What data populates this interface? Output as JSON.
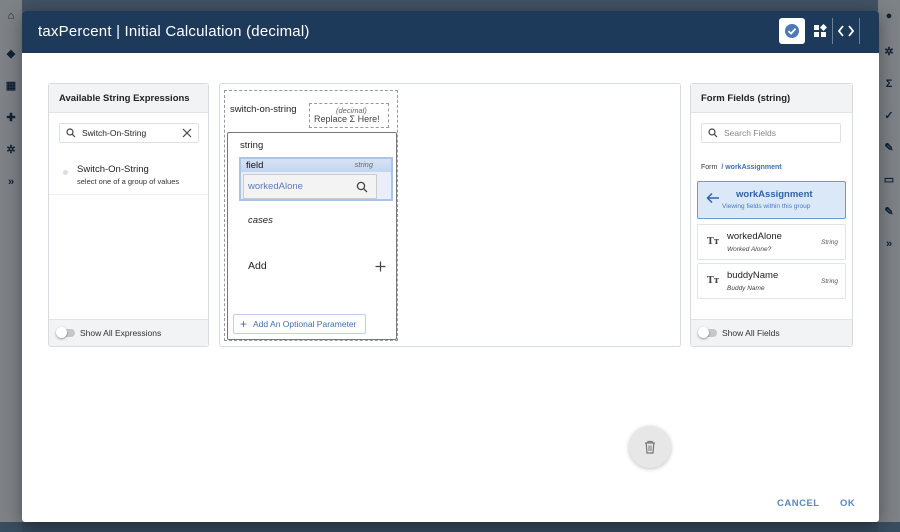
{
  "modal": {
    "title": "taxPercent | Initial Calculation (decimal)"
  },
  "header_actions": {
    "validate_icon": "check-circle-icon",
    "blocks_icon": "widgets-icon",
    "code_icon": "code-icon"
  },
  "expressions_panel": {
    "title": "Available String Expressions",
    "search_value": "Switch-On-String",
    "items": [
      {
        "name": "Switch-On-String",
        "description": "select one of a group of values"
      }
    ],
    "show_all_label": "Show All Expressions"
  },
  "editor": {
    "expression_label": "switch-on-string",
    "result_type": "(decimal)",
    "replace_label": "Replace Σ Here!",
    "block_label": "string",
    "field_label": "field",
    "field_type": "string",
    "field_value": "workedAlone",
    "cases_label": "cases",
    "add_label": "Add",
    "optional_param_label": "Add An Optional Parameter"
  },
  "form_fields_panel": {
    "title": "Form Fields (string)",
    "search_placeholder": "Search Fields",
    "path_root": "Form",
    "path_segment": "/ workAssignment",
    "group": {
      "name": "workAssignment",
      "subtitle": "Viewing fields within this group"
    },
    "fields": [
      {
        "name": "workedAlone",
        "label": "Worked Alone?",
        "type": "String",
        "icon": "text-type-icon"
      },
      {
        "name": "buddyName",
        "label": "Buddy Name",
        "type": "String",
        "icon": "text-type-icon"
      }
    ],
    "show_all_label": "Show All Fields"
  },
  "footer": {
    "cancel_label": "CANCEL",
    "ok_label": "OK"
  },
  "colors": {
    "header_bg": "#1e3a5a",
    "accent": "#3d6fb3",
    "selected_group_bg": "#dbe8f7"
  }
}
